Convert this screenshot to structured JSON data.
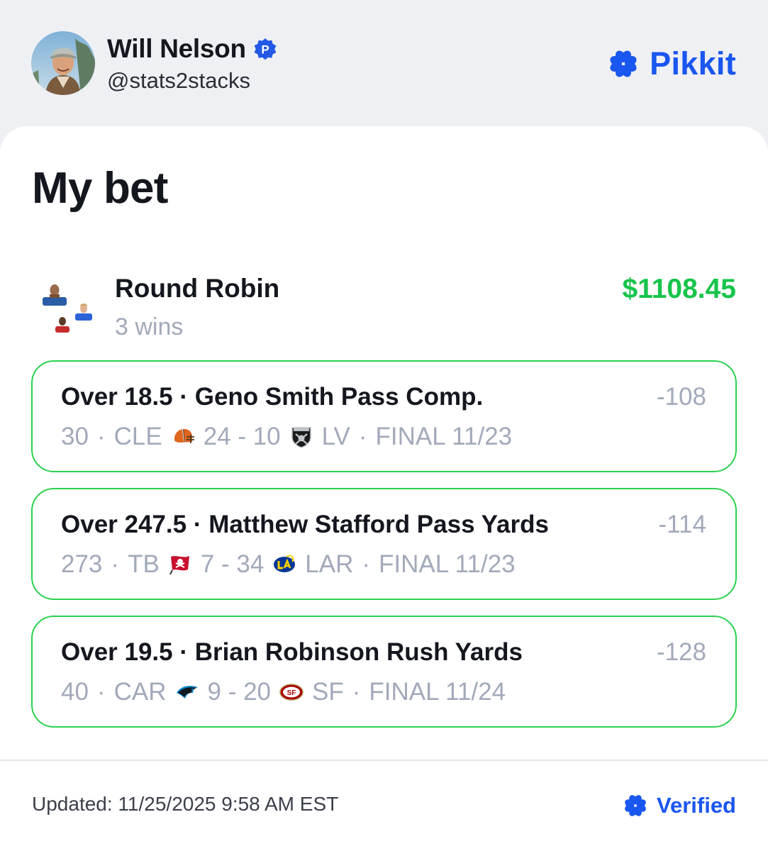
{
  "header": {
    "user_name": "Will Nelson",
    "user_handle": "@stats2stacks",
    "badge_icon": "pikkit-p-badge-icon",
    "brand": "Pikkit",
    "brand_color": "#1a56f0"
  },
  "bet": {
    "title": "My bet",
    "type": "Round Robin",
    "result": "3 wins",
    "payout": "$1108.45",
    "payout_color": "#17c44b",
    "legs": [
      {
        "title": "Over 18.5 · Geno Smith Pass Comp.",
        "odds": "-108",
        "stat": "30",
        "team_a": "CLE",
        "team_a_icon": "browns-helmet-icon",
        "score": "24 - 10",
        "team_b_icon": "raiders-shield-icon",
        "team_b": "LV",
        "status": "FINAL 11/23"
      },
      {
        "title": "Over 247.5 · Matthew Stafford Pass Yards",
        "odds": "-114",
        "stat": "273",
        "team_a": "TB",
        "team_a_icon": "buccaneers-flag-icon",
        "score": "7 - 34",
        "team_b_icon": "rams-la-icon",
        "team_b": "LAR",
        "status": "FINAL 11/23"
      },
      {
        "title": "Over 19.5 · Brian Robinson Rush Yards",
        "odds": "-128",
        "stat": "40",
        "team_a": "CAR",
        "team_a_icon": "panthers-icon",
        "score": "9 - 20",
        "team_b_icon": "49ers-oval-icon",
        "team_b": "SF",
        "status": "FINAL 11/24"
      }
    ],
    "leg_border_color": "#2bd150"
  },
  "footer": {
    "updated": "Updated: 11/25/2025 9:58 AM EST",
    "verified": "Verified"
  }
}
